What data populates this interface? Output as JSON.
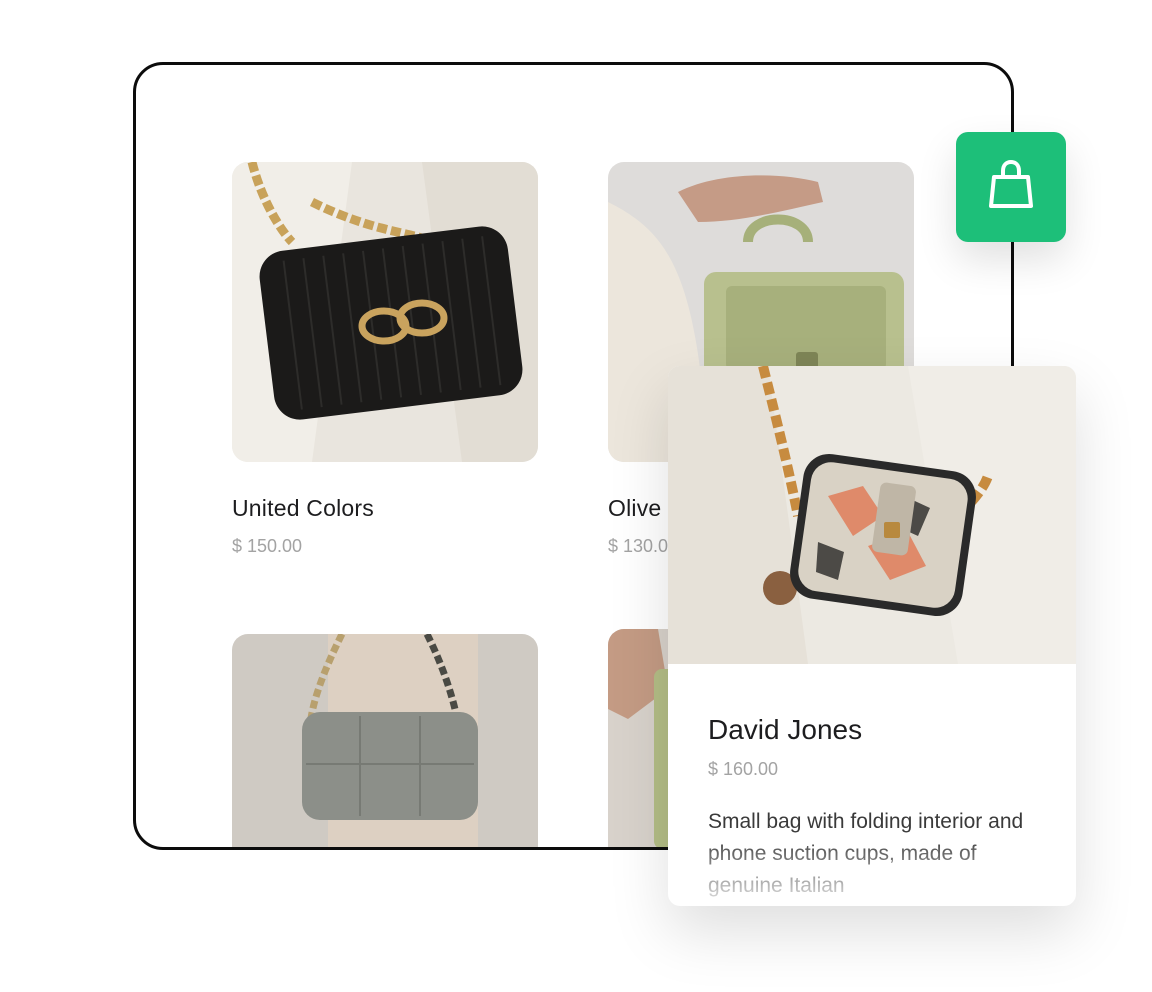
{
  "products": [
    {
      "name": "United Colors",
      "price": "$ 150.00",
      "image": "black-quilted-chain-bag-photo"
    },
    {
      "name": "Olive",
      "price": "$ 130.00",
      "image": "olive-green-top-handle-bag-photo"
    },
    {
      "name": "",
      "price": "",
      "image": "grey-quilted-shoulder-bag-photo"
    },
    {
      "name": "",
      "price": "",
      "image": "green-bag-held-in-hand-photo"
    }
  ],
  "cart": {
    "icon": "shopping-bag-icon",
    "color": "#1dbf79"
  },
  "detail": {
    "title": "David Jones",
    "price": "$ 160.00",
    "description": "Small bag with folding interior and phone suction cups, made of genuine Italian",
    "image": "snakeskin-belt-bag-photo"
  }
}
